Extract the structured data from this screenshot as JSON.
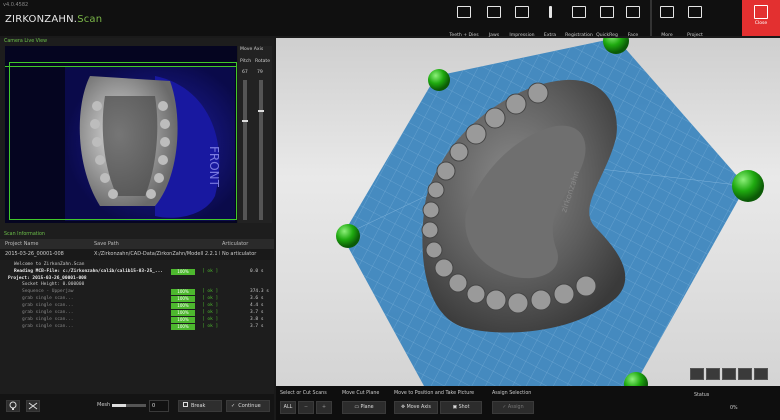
{
  "app": {
    "version": "v4.0.4582",
    "logo_brand": "ZIRKONZAHN.",
    "logo_suffix": "Scan"
  },
  "toolbar": {
    "items": [
      {
        "label": "Teeth + Dies",
        "icon": "teeth-dies-icon"
      },
      {
        "label": "Jaws",
        "icon": "jaws-icon"
      },
      {
        "label": "Impression",
        "icon": "impression-icon"
      },
      {
        "label": "Extra",
        "icon": "exclamation-icon"
      },
      {
        "label": "Registration",
        "icon": "registration-icon"
      },
      {
        "label": "QuickReg",
        "icon": "quickreg-icon"
      },
      {
        "label": "Face",
        "icon": "face-icon"
      }
    ],
    "right_items": [
      {
        "label": "More",
        "icon": "more-icon"
      },
      {
        "label": "Project",
        "icon": "project-icon"
      },
      {
        "label": "Close",
        "icon": "close-icon"
      }
    ]
  },
  "camera": {
    "title": "Camera Live View",
    "overlay_text": "FRONT",
    "move_axis_title": "Move Axis",
    "pitch_label": "Pitch",
    "rotate_label": "Rotate",
    "pitch_value": "67",
    "rotate_value": "79"
  },
  "scan_info": {
    "title": "Scan Information",
    "columns": [
      "Project Name",
      "Save Path",
      "Articulator"
    ],
    "row": {
      "project_name": "2015-03-26_00001-008",
      "save_path": "X:/Zirkonzahn/CAD-Data/ZirkonZahn/Modell 2.2.1 Bite Split",
      "articulator": "No articulator"
    }
  },
  "log": [
    {
      "text": "Welcome to ZirkonZahn.Scan",
      "bar": "",
      "ok": "",
      "time": ""
    },
    {
      "text": "Reading MCB-File: c:/Zirkonzahn/calib/calib15-03-25_...",
      "bar": "100%",
      "ok": "[ ok ]",
      "time": "0.0 s"
    },
    {
      "text": "Project: 2015-03-26_00001-008",
      "bar": "",
      "ok": "",
      "time": ""
    },
    {
      "text": "Socket Height: 0.000000",
      "bar": "",
      "ok": "",
      "time": ""
    },
    {
      "text": "Sequence - Upperjaw",
      "bar": "100%",
      "ok": "[ ok ]",
      "time": "374.3 s"
    },
    {
      "text": "grab single scan...",
      "bar": "100%",
      "ok": "[ ok ]",
      "time": "3.6 s"
    },
    {
      "text": "grab single scan...",
      "bar": "100%",
      "ok": "[ ok ]",
      "time": "4.4 s"
    },
    {
      "text": "grab single scan...",
      "bar": "100%",
      "ok": "[ ok ]",
      "time": "3.7 s"
    },
    {
      "text": "grab single scan...",
      "bar": "100%",
      "ok": "[ ok ]",
      "time": "3.8 s"
    },
    {
      "text": "grab single scan...",
      "bar": "100%",
      "ok": "[ ok ]",
      "time": "3.7 s"
    }
  ],
  "left_bottom": {
    "mesh_label": "Mesh",
    "mesh_value": "0",
    "break_label": "Break",
    "continue_label": "Continue"
  },
  "bottom": {
    "groups": {
      "select": "Select or Cut Scans",
      "move_plane": "Move Cut Plane",
      "move_pos": "Move to Position and Take Picture",
      "assign": "Assign Selection"
    },
    "buttons": {
      "all": "ALL",
      "plane": "Plane",
      "move_axis": "Move Axis",
      "shot": "Shot",
      "assign": "Assign"
    },
    "status_label": "Status",
    "status_value": "0%"
  },
  "colors": {
    "accent_green": "#4db82e",
    "close_red": "#e33030",
    "plane_blue": "#3d86be"
  }
}
